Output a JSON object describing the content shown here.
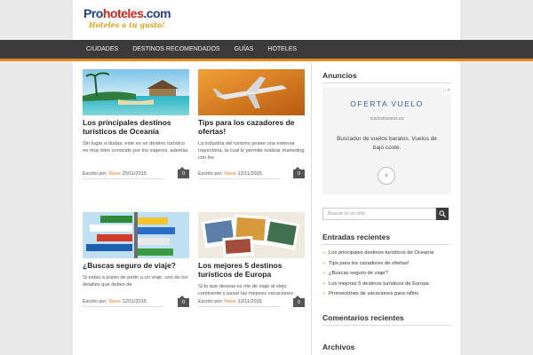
{
  "header": {
    "logo_main_1": "Pro",
    "logo_main_2": "hoteles",
    "logo_main_3": ".com",
    "logo_tagline": "Hoteles a tu gusto!"
  },
  "nav": {
    "items": [
      {
        "label": "CIUDADES"
      },
      {
        "label": "DESTINOS RECOMENDADOS"
      },
      {
        "label": "GUÍAS"
      },
      {
        "label": "HOTELES"
      }
    ]
  },
  "posts": [
    {
      "title": "Los principales destinos turísticos de Oceanía",
      "excerpt": "Sin lugar a dudas, este es un destino turístico no muy bien conocido por los viajeros, además",
      "meta_prefix": "Escrito por:",
      "author": "Mene",
      "date": "25/11/2015",
      "comments": "0"
    },
    {
      "title": "Tips para los cazadores de ofertas!",
      "excerpt": "La industria del turismo posee una extensa trayectoria, la cual le permite realizar marketing con los",
      "meta_prefix": "Escrito por:",
      "author": "Mene",
      "date": "12/11/2015",
      "comments": "0"
    },
    {
      "title": "¿Buscas seguro de viaje?",
      "excerpt": "Si estas a punto de partir a un viaje, uno de los detalles que debes de",
      "meta_prefix": "Escrito por:",
      "author": "Mene",
      "date": "12/11/2015",
      "comments": "0"
    },
    {
      "title": "Los mejores 5 destinos turísticos de Europa",
      "excerpt": "Si lo que deseas es irte de viaje al viejo continente y pasar las mejores vacaciones",
      "meta_prefix": "Escrito por:",
      "author": "Mene",
      "date": "12/11/2015",
      "comments": "0"
    }
  ],
  "sidebar": {
    "ads_title": "Anuncios",
    "ad": {
      "headline": "OFERTA VUELO",
      "url": "vuelosbaratos.es",
      "text": "Buscador de vuelos baratos. Vuelos de bajo coste.",
      "arrow": "›",
      "mark": "▷✕"
    },
    "search_placeholder": "Buscar en el sitio",
    "recent_title": "Entradas recientes",
    "recent_items": [
      "Los principales destinos turísticos de Oceanía",
      "Tips para los cazadores de ofertas!",
      "¿Buscas seguro de viaje?",
      "Los mejores 5 destinos turísticos de Europa",
      "Promociones de vacaciones para niños"
    ],
    "comments_title": "Comentarios recientes",
    "archives_title": "Archivos"
  },
  "colors": {
    "accent": "#e5871d",
    "nav_bg": "#3b3b3b",
    "link_blue": "#2463b8"
  }
}
